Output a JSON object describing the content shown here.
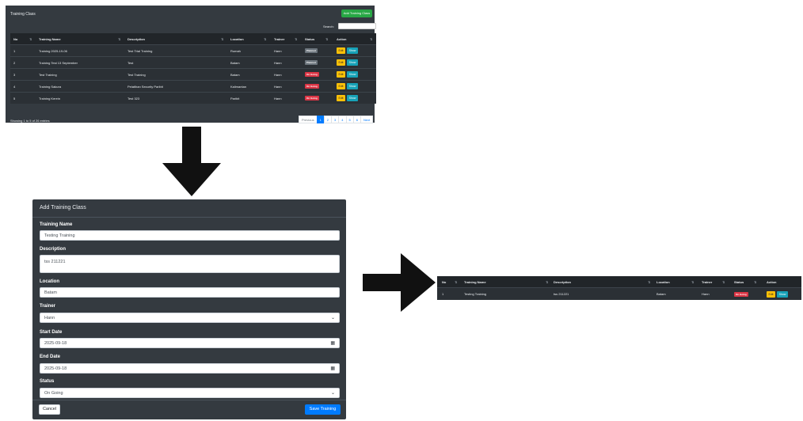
{
  "list": {
    "title": "Training Class",
    "add_button": "Add Training Class",
    "search_label": "Search:",
    "columns": [
      "No",
      "Training Name",
      "Description",
      "Location",
      "Trainer",
      "Status",
      "Action"
    ],
    "rows": [
      {
        "no": "1",
        "name": "Training 2025-19-06",
        "description": "Test Trial Training",
        "location": "Rumah",
        "trainer": "Hann",
        "status": "Planned",
        "status_kind": "planned"
      },
      {
        "no": "2",
        "name": "Training Test 13 September",
        "description": "Test",
        "location": "Batam",
        "trainer": "Hann",
        "status": "Planned",
        "status_kind": "planned"
      },
      {
        "no": "3",
        "name": "Test Training",
        "description": "Test Training",
        "location": "Batam",
        "trainer": "Hann",
        "status": "On Going",
        "status_kind": "ongoing"
      },
      {
        "no": "4",
        "name": "Training Sakura",
        "description": "Pelatihan Security Paribit",
        "location": "Kalimantan",
        "trainer": "Hann",
        "status": "On Going",
        "status_kind": "ongoing"
      },
      {
        "no": "5",
        "name": "Training Kerein",
        "description": "Test 323",
        "location": "Paribit",
        "trainer": "Hann",
        "status": "On Going",
        "status_kind": "ongoing"
      }
    ],
    "edit_label": "Edit",
    "show_label": "Show",
    "footer_info": "Showing 1 to 5 of 26 entries",
    "pager": [
      "Previous",
      "1",
      "2",
      "3",
      "4",
      "5",
      "6",
      "Next"
    ]
  },
  "modal": {
    "title": "Add Training Class",
    "fields": {
      "training_name": {
        "label": "Training Name",
        "value": "Testing Training"
      },
      "description": {
        "label": "Description",
        "value": "tss 211221"
      },
      "location": {
        "label": "Location",
        "value": "Batam"
      },
      "trainer": {
        "label": "Trainer",
        "value": "Hann"
      },
      "start_date": {
        "label": "Start Date",
        "value": "2025-09-18"
      },
      "end_date": {
        "label": "End Date",
        "value": "2025-09-18"
      },
      "status": {
        "label": "Status",
        "value": "On Going"
      }
    },
    "cancel_label": "Cancel",
    "save_label": "Save Training"
  },
  "result": {
    "row": {
      "no": "1",
      "name": "Testing Training",
      "description": "tss 211221",
      "location": "Batam",
      "trainer": "Hann",
      "status": "On Going",
      "status_kind": "ongoing"
    }
  },
  "icons": {
    "sort": "sort-arrows-icon",
    "calendar": "calendar-icon",
    "chevron": "chevron-down-icon"
  },
  "colors": {
    "panel": "#343a40",
    "add": "#28a745",
    "edit": "#ffc107",
    "show": "#17a2b8",
    "save": "#007bff",
    "planned": "#6c757d",
    "ongoing": "#dc3545"
  }
}
